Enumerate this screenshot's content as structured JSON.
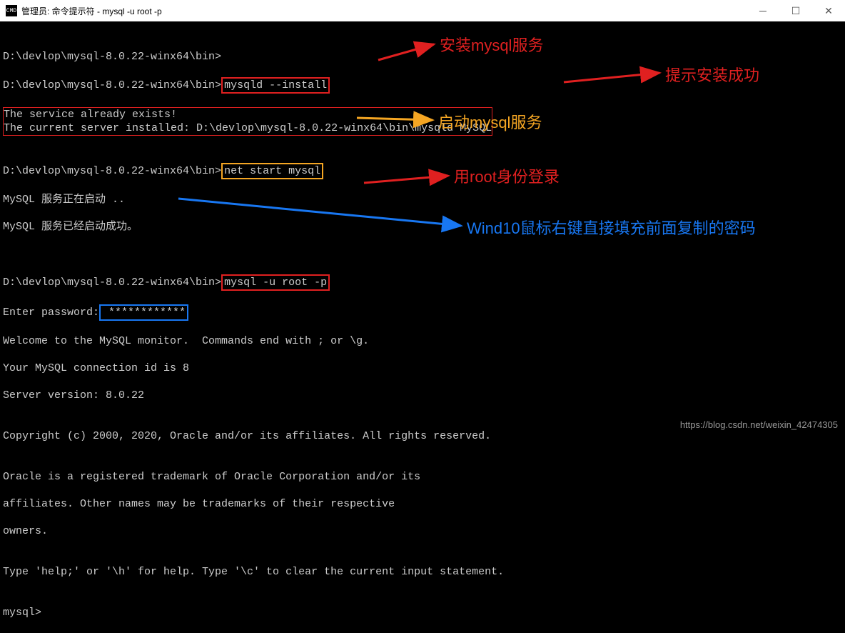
{
  "window": {
    "title": "管理员: 命令提示符 - mysql  -u root -p",
    "icon_label": "CMD"
  },
  "terminal": {
    "blank1": "",
    "prompt1": "D:\\devlop\\mysql-8.0.22-winx64\\bin>",
    "prompt2_prefix": "D:\\devlop\\mysql-8.0.22-winx64\\bin>",
    "cmd_install": "mysqld --install",
    "resp_install_1": "The service already exists!",
    "resp_install_2": "The current server installed: D:\\devlop\\mysql-8.0.22-winx64\\bin\\mysqld MySQL",
    "blank2": "",
    "prompt3_prefix": "D:\\devlop\\mysql-8.0.22-winx64\\bin>",
    "cmd_netstart": "net start mysql",
    "resp_netstart_1": "MySQL 服务正在启动 ..",
    "resp_netstart_2": "MySQL 服务已经启动成功。",
    "blank3": "",
    "blank4": "",
    "prompt4_prefix": "D:\\devlop\\mysql-8.0.22-winx64\\bin>",
    "cmd_login": "mysql -u root -p",
    "pw_label": "Enter password:",
    "pw_mask": " ************",
    "welcome_1": "Welcome to the MySQL monitor.  Commands end with ; or \\g.",
    "welcome_2": "Your MySQL connection id is 8",
    "welcome_3": "Server version: 8.0.22",
    "blank5": "",
    "copyright": "Copyright (c) 2000, 2020, Oracle and/or its affiliates. All rights reserved.",
    "blank6": "",
    "oracle_1": "Oracle is a registered trademark of Oracle Corporation and/or its",
    "oracle_2": "affiliates. Other names may be trademarks of their respective",
    "oracle_3": "owners.",
    "blank7": "",
    "help": "Type 'help;' or '\\h' for help. Type '\\c' to clear the current input statement.",
    "blank8": "",
    "mysql_prompt": "mysql>"
  },
  "annotations": {
    "install": "安装mysql服务",
    "success": "提示安装成功",
    "start": "启动mysql服务",
    "login": "用root身份登录",
    "password": "Wind10鼠标右键直接填充前面复制的密码"
  },
  "watermark": "https://blog.csdn.net/weixin_42474305"
}
